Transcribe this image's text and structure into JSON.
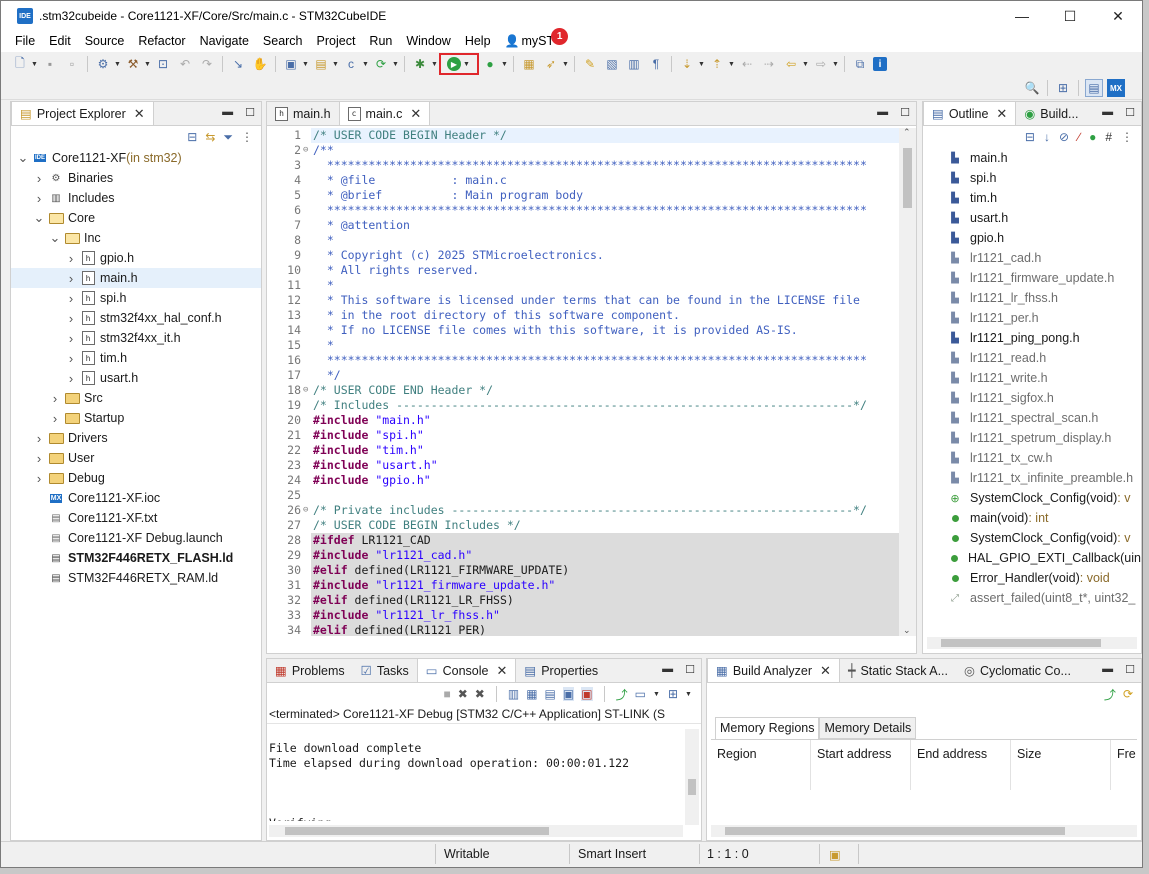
{
  "window": {
    "title": ".stm32cubeide - Core1121-XF/Core/Src/main.c - STM32CubeIDE",
    "app_icon_label": "IDE",
    "minimize": "—",
    "maximize": "☐",
    "close": "✕"
  },
  "menu": {
    "items": [
      "File",
      "Edit",
      "Source",
      "Refactor",
      "Navigate",
      "Search",
      "Project",
      "Run",
      "Window",
      "Help"
    ],
    "user_label": "myST",
    "badge_count": "1"
  },
  "project_explorer": {
    "tab_label": "Project Explorer",
    "tree": [
      {
        "label": "Core1121-XF",
        "suffix": " (in stm32)",
        "level": 0,
        "twisty": "v",
        "icon": "project-icon"
      },
      {
        "label": "Binaries",
        "level": 1,
        "twisty": ">",
        "icon": "binaries-icon"
      },
      {
        "label": "Includes",
        "level": 1,
        "twisty": ">",
        "icon": "includes-icon"
      },
      {
        "label": "Core",
        "level": 1,
        "twisty": "v",
        "icon": "folder-open-icon"
      },
      {
        "label": "Inc",
        "level": 2,
        "twisty": "v",
        "icon": "folder-open-icon"
      },
      {
        "label": "gpio.h",
        "level": 3,
        "twisty": ">",
        "icon": "header-file-icon"
      },
      {
        "label": "main.h",
        "level": 3,
        "twisty": ">",
        "icon": "header-file-icon",
        "selected": true
      },
      {
        "label": "spi.h",
        "level": 3,
        "twisty": ">",
        "icon": "header-file-icon"
      },
      {
        "label": "stm32f4xx_hal_conf.h",
        "level": 3,
        "twisty": ">",
        "icon": "header-file-icon"
      },
      {
        "label": "stm32f4xx_it.h",
        "level": 3,
        "twisty": ">",
        "icon": "header-file-icon"
      },
      {
        "label": "tim.h",
        "level": 3,
        "twisty": ">",
        "icon": "header-file-icon"
      },
      {
        "label": "usart.h",
        "level": 3,
        "twisty": ">",
        "icon": "header-file-icon"
      },
      {
        "label": "Src",
        "level": 2,
        "twisty": ">",
        "icon": "folder-icon"
      },
      {
        "label": "Startup",
        "level": 2,
        "twisty": ">",
        "icon": "folder-icon"
      },
      {
        "label": "Drivers",
        "level": 1,
        "twisty": ">",
        "icon": "folder-icon"
      },
      {
        "label": "User",
        "level": 1,
        "twisty": ">",
        "icon": "folder-icon"
      },
      {
        "label": "Debug",
        "level": 1,
        "twisty": ">",
        "icon": "folder-icon"
      },
      {
        "label": "Core1121-XF.ioc",
        "level": 1,
        "twisty": "",
        "icon": "mx-icon"
      },
      {
        "label": "Core1121-XF.txt",
        "level": 1,
        "twisty": "",
        "icon": "text-file-icon"
      },
      {
        "label": "Core1121-XF Debug.launch",
        "level": 1,
        "twisty": "",
        "icon": "launch-file-icon"
      },
      {
        "label": "STM32F446RETX_FLASH.ld",
        "level": 1,
        "twisty": "",
        "icon": "ld-file-icon",
        "bold": true
      },
      {
        "label": "STM32F446RETX_RAM.ld",
        "level": 1,
        "twisty": "",
        "icon": "ld-file-icon"
      }
    ]
  },
  "editor": {
    "tabs": [
      {
        "label": "main.h",
        "icon": "h",
        "active": false
      },
      {
        "label": "main.c",
        "icon": "c",
        "active": true
      }
    ],
    "lines": [
      {
        "n": "1",
        "fold": "",
        "t": "/* USER CODE BEGIN Header */",
        "k": "cm",
        "first": true
      },
      {
        "n": "2",
        "fold": "⊖",
        "t": "/**",
        "k": "cm2"
      },
      {
        "n": "3",
        "fold": "",
        "t": "  ******************************************************************************",
        "k": "cm2"
      },
      {
        "n": "4",
        "fold": "",
        "t": "  * @file           : main.c",
        "k": "cm2"
      },
      {
        "n": "5",
        "fold": "",
        "t": "  * @brief          : Main program body",
        "k": "cm2"
      },
      {
        "n": "6",
        "fold": "",
        "t": "  ******************************************************************************",
        "k": "cm2"
      },
      {
        "n": "7",
        "fold": "",
        "t": "  * @attention",
        "k": "cm2"
      },
      {
        "n": "8",
        "fold": "",
        "t": "  *",
        "k": "cm2"
      },
      {
        "n": "9",
        "fold": "",
        "t": "  * Copyright (c) 2025 STMicroelectronics.",
        "k": "cm2"
      },
      {
        "n": "10",
        "fold": "",
        "t": "  * All rights reserved.",
        "k": "cm2"
      },
      {
        "n": "11",
        "fold": "",
        "t": "  *",
        "k": "cm2"
      },
      {
        "n": "12",
        "fold": "",
        "t": "  * This software is licensed under terms that can be found in the LICENSE file",
        "k": "cm2"
      },
      {
        "n": "13",
        "fold": "",
        "t": "  * in the root directory of this software component.",
        "k": "cm2"
      },
      {
        "n": "14",
        "fold": "",
        "t": "  * If no LICENSE file comes with this software, it is provided AS-IS.",
        "k": "cm2"
      },
      {
        "n": "15",
        "fold": "",
        "t": "  *",
        "k": "cm2"
      },
      {
        "n": "16",
        "fold": "",
        "t": "  ******************************************************************************",
        "k": "cm2"
      },
      {
        "n": "17",
        "fold": "",
        "t": "  */",
        "k": "cm2"
      },
      {
        "n": "18",
        "fold": "⊖",
        "t": "/* USER CODE END Header */",
        "k": "cm"
      },
      {
        "n": "19",
        "fold": "",
        "t": "/* Includes ------------------------------------------------------------------*/",
        "k": "cm"
      },
      {
        "n": "20",
        "fold": "",
        "kw": "#include ",
        "st": "\"main.h\""
      },
      {
        "n": "21",
        "fold": "",
        "kw": "#include ",
        "st": "\"spi.h\""
      },
      {
        "n": "22",
        "fold": "",
        "kw": "#include ",
        "st": "\"tim.h\""
      },
      {
        "n": "23",
        "fold": "",
        "kw": "#include ",
        "st": "\"usart.h\""
      },
      {
        "n": "24",
        "fold": "",
        "kw": "#include ",
        "st": "\"gpio.h\""
      },
      {
        "n": "25",
        "fold": "",
        "t": "",
        "k": ""
      },
      {
        "n": "26",
        "fold": "⊖",
        "t": "/* Private includes ----------------------------------------------------------*/",
        "k": "cm"
      },
      {
        "n": "27",
        "fold": "",
        "t": "/* USER CODE BEGIN Includes */",
        "k": "cm"
      },
      {
        "n": "28",
        "fold": "",
        "kw": "#ifdef ",
        "rest": "LR1121_CAD",
        "shade": true
      },
      {
        "n": "29",
        "fold": "",
        "kw": "#include ",
        "st": "\"lr1121_cad.h\"",
        "shade": true
      },
      {
        "n": "30",
        "fold": "",
        "kw": "#elif ",
        "rest": "defined(LR1121_FIRMWARE_UPDATE)",
        "shade": true
      },
      {
        "n": "31",
        "fold": "",
        "kw": "#include ",
        "st": "\"lr1121_firmware_update.h\"",
        "shade": true
      },
      {
        "n": "32",
        "fold": "",
        "kw": "#elif ",
        "rest": "defined(LR1121_LR_FHSS)",
        "shade": true
      },
      {
        "n": "33",
        "fold": "",
        "kw": "#include ",
        "st": "\"lr1121_lr_fhss.h\"",
        "shade": true
      },
      {
        "n": "34",
        "fold": "",
        "kw": "#elif ",
        "rest": "defined(LR1121_PER)",
        "shade": true
      }
    ]
  },
  "outline": {
    "tab_label": "Outline",
    "tab2_label": "Build...",
    "items": [
      {
        "label": "main.h",
        "type": "inc"
      },
      {
        "label": "spi.h",
        "type": "inc"
      },
      {
        "label": "tim.h",
        "type": "inc"
      },
      {
        "label": "usart.h",
        "type": "inc"
      },
      {
        "label": "gpio.h",
        "type": "inc"
      },
      {
        "label": "lr1121_cad.h",
        "type": "inc-d"
      },
      {
        "label": "lr1121_firmware_update.h",
        "type": "inc-d"
      },
      {
        "label": "lr1121_lr_fhss.h",
        "type": "inc-d"
      },
      {
        "label": "lr1121_per.h",
        "type": "inc-d"
      },
      {
        "label": "lr1121_ping_pong.h",
        "type": "inc"
      },
      {
        "label": "lr1121_read.h",
        "type": "inc-d"
      },
      {
        "label": "lr1121_write.h",
        "type": "inc-d"
      },
      {
        "label": "lr1121_sigfox.h",
        "type": "inc-d"
      },
      {
        "label": "lr1121_spectral_scan.h",
        "type": "inc-d"
      },
      {
        "label": "lr1121_spetrum_display.h",
        "type": "inc-d"
      },
      {
        "label": "lr1121_tx_cw.h",
        "type": "inc-d"
      },
      {
        "label": "lr1121_tx_infinite_preamble.h",
        "type": "inc-d"
      },
      {
        "label": "SystemClock_Config(void)",
        "suffix": " : v",
        "type": "proto"
      },
      {
        "label": "main(void)",
        "suffix": " : int",
        "type": "func"
      },
      {
        "label": "SystemClock_Config(void)",
        "suffix": " : v",
        "type": "func"
      },
      {
        "label": "HAL_GPIO_EXTI_Callback(uin",
        "suffix": "",
        "type": "func"
      },
      {
        "label": "Error_Handler(void)",
        "suffix": " : void",
        "type": "func"
      },
      {
        "label": "assert_failed(uint8_t*, uint32_",
        "suffix": "",
        "type": "func-d"
      }
    ]
  },
  "console": {
    "tabs": [
      "Problems",
      "Tasks",
      "Console",
      "Properties"
    ],
    "terminated": "<terminated> Core1121-XF Debug [STM32 C/C++ Application] ST-LINK (S",
    "lines": [
      "",
      "File download complete",
      "Time elapsed during download operation: 00:00:01.122",
      "",
      "",
      "",
      "Verifying..."
    ]
  },
  "build_analyzer": {
    "tabs": [
      "Build Analyzer",
      "Static Stack A...",
      "Cyclomatic Co..."
    ],
    "subtabs": [
      "Memory Regions",
      "Memory Details"
    ],
    "columns": [
      "Region",
      "Start address",
      "End address",
      "Size",
      "Fre"
    ]
  },
  "statusbar": {
    "writable": "Writable",
    "insert_mode": "Smart Insert",
    "position": "1 : 1 : 0"
  },
  "colors": {
    "accent_red": "#e0272c",
    "run_green": "#2ea043"
  }
}
